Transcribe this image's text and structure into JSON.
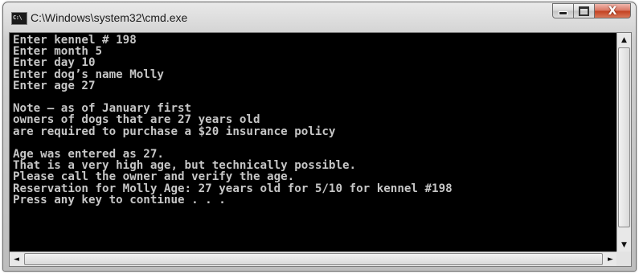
{
  "window": {
    "title": "C:\\Windows\\system32\\cmd.exe",
    "icon_text": "C:\\",
    "icon": "console-icon",
    "buttons": {
      "minimize": "minimize-icon",
      "maximize": "maximize-icon",
      "close": "close-icon",
      "close_glyph": "X"
    }
  },
  "console": {
    "lines": [
      "Enter kennel # 198",
      "Enter month 5",
      "Enter day 10",
      "Enter dog’s name Molly",
      "Enter age 27",
      "",
      "Note – as of January first",
      "owners of dogs that are 27 years old",
      "are required to purchase a $20 insurance policy",
      "",
      "Age was entered as 27.",
      "That is a very high age, but technically possible.",
      "Please call the owner and verify the age.",
      "Reservation for Molly Age: 27 years old for 5/10 for kennel #198",
      "Press any key to continue . . ."
    ],
    "background": "#000000",
    "foreground": "#c6c6c6"
  },
  "scrollbars": {
    "up_glyph": "▲",
    "down_glyph": "▼",
    "left_glyph": "◄",
    "right_glyph": "►"
  }
}
